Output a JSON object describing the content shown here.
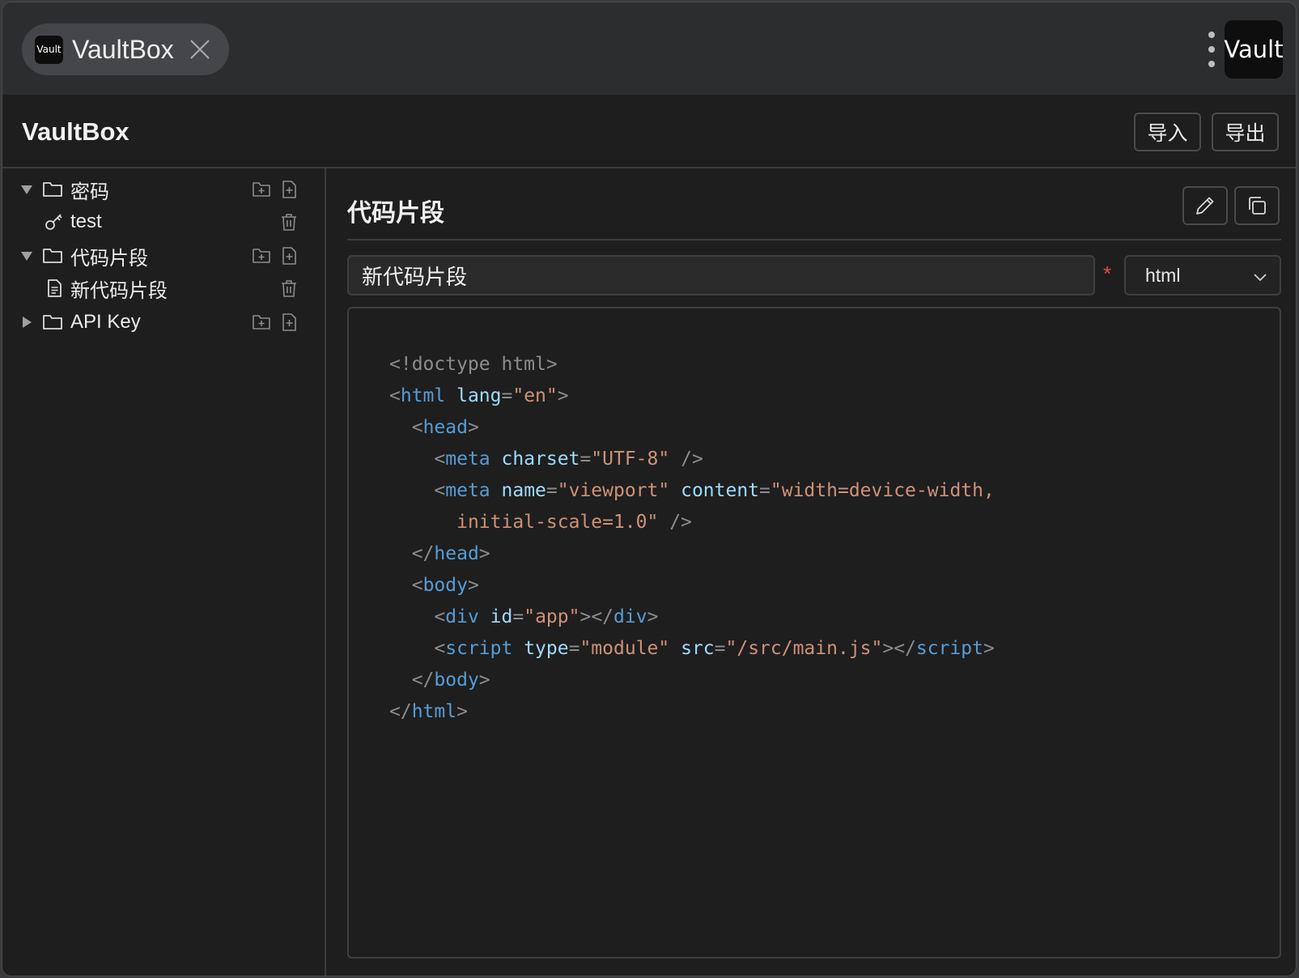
{
  "tab": {
    "logo_text": "Vault",
    "title": "VaultBox"
  },
  "topright": {
    "vault_label": "Vault"
  },
  "header": {
    "title": "VaultBox",
    "import_label": "导入",
    "export_label": "导出"
  },
  "sidebar": {
    "items": [
      {
        "type": "folder",
        "label": "密码",
        "expanded": true
      },
      {
        "type": "password",
        "label": "test"
      },
      {
        "type": "folder",
        "label": "代码片段",
        "expanded": true
      },
      {
        "type": "snippet",
        "label": "新代码片段"
      },
      {
        "type": "folder",
        "label": "API Key",
        "expanded": false
      }
    ]
  },
  "main": {
    "section_title": "代码片段",
    "name_value": "新代码片段",
    "required_mark": "*",
    "language": "html",
    "code_lines": [
      [
        [
          "punc",
          "<!doctype html>"
        ]
      ],
      [
        [
          "punc",
          "<"
        ],
        [
          "tag",
          "html"
        ],
        [
          "plain",
          " "
        ],
        [
          "attr",
          "lang"
        ],
        [
          "punc",
          "="
        ],
        [
          "str",
          "\"en\""
        ],
        [
          "punc",
          ">"
        ]
      ],
      [
        [
          "plain",
          "  "
        ],
        [
          "punc",
          "<"
        ],
        [
          "tag",
          "head"
        ],
        [
          "punc",
          ">"
        ]
      ],
      [
        [
          "plain",
          "    "
        ],
        [
          "punc",
          "<"
        ],
        [
          "tag",
          "meta"
        ],
        [
          "plain",
          " "
        ],
        [
          "attr",
          "charset"
        ],
        [
          "punc",
          "="
        ],
        [
          "str",
          "\"UTF-8\""
        ],
        [
          "plain",
          " "
        ],
        [
          "punc",
          "/>"
        ]
      ],
      [
        [
          "plain",
          "    "
        ],
        [
          "punc",
          "<"
        ],
        [
          "tag",
          "meta"
        ],
        [
          "plain",
          " "
        ],
        [
          "attr",
          "name"
        ],
        [
          "punc",
          "="
        ],
        [
          "str",
          "\"viewport\""
        ],
        [
          "plain",
          " "
        ],
        [
          "attr",
          "content"
        ],
        [
          "punc",
          "="
        ],
        [
          "str",
          "\"width=device-width,"
        ]
      ],
      [
        [
          "plain",
          "      "
        ],
        [
          "str",
          "initial-scale=1.0\""
        ],
        [
          "plain",
          " "
        ],
        [
          "punc",
          "/>"
        ]
      ],
      [
        [
          "plain",
          "  "
        ],
        [
          "punc",
          "</"
        ],
        [
          "tag",
          "head"
        ],
        [
          "punc",
          ">"
        ]
      ],
      [
        [
          "plain",
          "  "
        ],
        [
          "punc",
          "<"
        ],
        [
          "tag",
          "body"
        ],
        [
          "punc",
          ">"
        ]
      ],
      [
        [
          "plain",
          "    "
        ],
        [
          "punc",
          "<"
        ],
        [
          "tag",
          "div"
        ],
        [
          "plain",
          " "
        ],
        [
          "attr",
          "id"
        ],
        [
          "punc",
          "="
        ],
        [
          "str",
          "\"app\""
        ],
        [
          "punc",
          "></"
        ],
        [
          "tag",
          "div"
        ],
        [
          "punc",
          ">"
        ]
      ],
      [
        [
          "plain",
          "    "
        ],
        [
          "punc",
          "<"
        ],
        [
          "tag",
          "script"
        ],
        [
          "plain",
          " "
        ],
        [
          "attr",
          "type"
        ],
        [
          "punc",
          "="
        ],
        [
          "str",
          "\"module\""
        ],
        [
          "plain",
          " "
        ],
        [
          "attr",
          "src"
        ],
        [
          "punc",
          "="
        ],
        [
          "str",
          "\"/src/main.js\""
        ],
        [
          "punc",
          "></"
        ],
        [
          "tag",
          "script"
        ],
        [
          "punc",
          ">"
        ]
      ],
      [
        [
          "plain",
          "  "
        ],
        [
          "punc",
          "</"
        ],
        [
          "tag",
          "body"
        ],
        [
          "punc",
          ">"
        ]
      ],
      [
        [
          "punc",
          "</"
        ],
        [
          "tag",
          "html"
        ],
        [
          "punc",
          ">"
        ]
      ]
    ]
  },
  "colors": {
    "background": "#1e1e1e",
    "tabbar": "#2c2d2f",
    "accent_required": "#e5484d",
    "code_tag": "#569cd6",
    "code_attr": "#9cdcfe",
    "code_string": "#ce9178",
    "code_punct": "#8c8c8c"
  }
}
